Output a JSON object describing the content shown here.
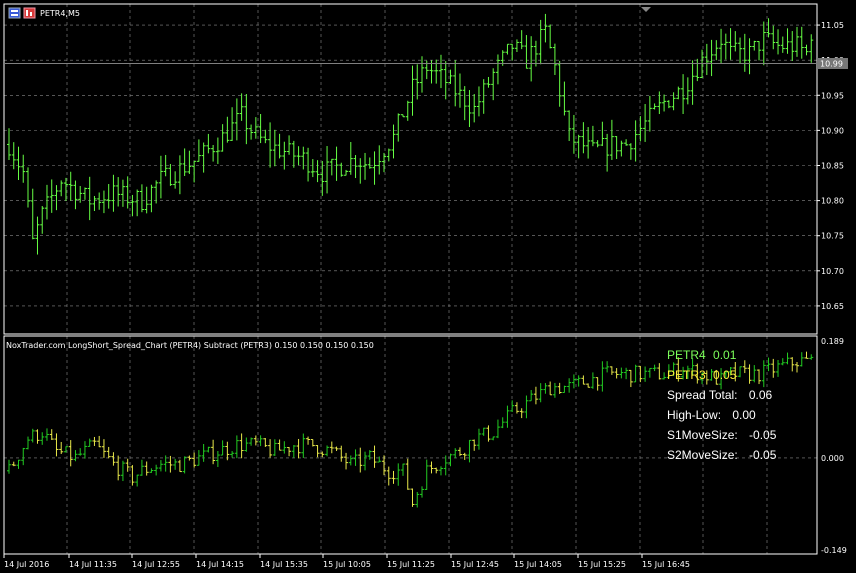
{
  "colors": {
    "background": "#000000",
    "grid": "#8a8a8a",
    "bull": "#66ff44",
    "bear": "#66ff44",
    "spread_up": "#22cc22",
    "spread_down": "#e8e84a",
    "text": "#ffffff",
    "price_line": "#808080",
    "price_tag_bg": "#777777"
  },
  "main_title": "PETR4,M5",
  "indicator_title": "NoxTrader.com LongShort_Spread_Chart (PETR4) Subtract (PETR3) 0.150 0.150 0.150 0.150",
  "price_tag": "10.99",
  "info_panel": {
    "petr4_label": "PETR4",
    "petr4_value": "0.01",
    "petr3_label": "PETR3",
    "petr3_value": "0.05",
    "spread_label": "Spread Total:",
    "spread_value": "0.06",
    "highlow_label": "High-Low:",
    "highlow_value": "0.00",
    "s1_label": "S1MoveSize:",
    "s1_value": "-0.05",
    "s2_label": "S2MoveSize:",
    "s2_value": "-0.05"
  },
  "chart_data": [
    {
      "type": "candlestick",
      "symbol": "PETR4,M5",
      "ylim": [
        10.61,
        11.08
      ],
      "y_ticks": [
        "11.05",
        "11.00",
        "10.95",
        "10.90",
        "10.85",
        "10.80",
        "10.75",
        "10.70",
        "10.65"
      ],
      "current_price": 10.99,
      "x_ticks": [
        "14 Jul 2016",
        "14 Jul 11:35",
        "14 Jul 12:55",
        "14 Jul 14:15",
        "14 Jul 15:35",
        "15 Jul 10:05",
        "15 Jul 11:25",
        "15 Jul 12:45",
        "15 Jul 14:05",
        "15 Jul 15:25",
        "15 Jul 16:45"
      ],
      "close_path": [
        [
          0,
          10.88
        ],
        [
          3,
          10.84
        ],
        [
          5,
          10.74
        ],
        [
          7,
          10.78
        ],
        [
          11,
          10.83
        ],
        [
          17,
          10.8
        ],
        [
          22,
          10.81
        ],
        [
          28,
          10.8
        ],
        [
          32,
          10.83
        ],
        [
          40,
          10.86
        ],
        [
          45,
          10.89
        ],
        [
          49,
          10.92
        ],
        [
          51,
          10.9
        ],
        [
          54,
          10.88
        ],
        [
          58,
          10.87
        ],
        [
          62,
          10.86
        ],
        [
          66,
          10.84
        ],
        [
          70,
          10.85
        ],
        [
          73,
          10.86
        ],
        [
          76,
          10.85
        ],
        [
          81,
          10.89
        ],
        [
          85,
          10.96
        ],
        [
          88,
          10.99
        ],
        [
          92,
          10.97
        ],
        [
          95,
          10.95
        ],
        [
          98,
          10.93
        ],
        [
          102,
          10.98
        ],
        [
          106,
          11.02
        ],
        [
          109,
          11.0
        ],
        [
          113,
          11.04
        ],
        [
          115,
          10.99
        ],
        [
          118,
          10.89
        ],
        [
          123,
          10.87
        ],
        [
          127,
          10.88
        ],
        [
          130,
          10.88
        ],
        [
          134,
          10.91
        ],
        [
          138,
          10.94
        ],
        [
          142,
          10.96
        ],
        [
          146,
          11.0
        ],
        [
          150,
          11.03
        ],
        [
          152,
          11.01
        ],
        [
          156,
          11.01
        ],
        [
          159,
          11.03
        ],
        [
          162,
          11.02
        ],
        [
          166,
          11.02
        ],
        [
          168,
          11.01
        ],
        [
          169,
          11.04
        ]
      ]
    },
    {
      "type": "bar",
      "name": "LongShort_Spread_Chart (PETR4) Subtract (PETR3)",
      "ylim": [
        -0.149,
        0.189
      ],
      "y_ticks": [
        "0.189",
        "0.000",
        "-0.149"
      ],
      "path": [
        [
          0,
          -0.02
        ],
        [
          4,
          0.03
        ],
        [
          7,
          0.04
        ],
        [
          10,
          0.01
        ],
        [
          14,
          0.0
        ],
        [
          18,
          0.02
        ],
        [
          22,
          -0.01
        ],
        [
          26,
          -0.03
        ],
        [
          28,
          -0.02
        ],
        [
          32,
          -0.01
        ],
        [
          36,
          -0.01
        ],
        [
          40,
          0.0
        ],
        [
          44,
          0.01
        ],
        [
          48,
          0.02
        ],
        [
          52,
          0.02
        ],
        [
          56,
          0.01
        ],
        [
          60,
          0.02
        ],
        [
          64,
          0.02
        ],
        [
          68,
          0.01
        ],
        [
          72,
          -0.01
        ],
        [
          76,
          0.0
        ],
        [
          80,
          -0.02
        ],
        [
          83,
          -0.02
        ],
        [
          85,
          -0.07
        ],
        [
          88,
          -0.02
        ],
        [
          92,
          0.0
        ],
        [
          95,
          0.01
        ],
        [
          98,
          0.03
        ],
        [
          102,
          0.04
        ],
        [
          106,
          0.07
        ],
        [
          110,
          0.09
        ],
        [
          114,
          0.11
        ],
        [
          118,
          0.11
        ],
        [
          122,
          0.12
        ],
        [
          126,
          0.13
        ],
        [
          130,
          0.13
        ],
        [
          134,
          0.13
        ],
        [
          138,
          0.13
        ],
        [
          142,
          0.14
        ],
        [
          146,
          0.13
        ],
        [
          150,
          0.12
        ],
        [
          152,
          0.13
        ],
        [
          155,
          0.13
        ],
        [
          158,
          0.13
        ],
        [
          162,
          0.14
        ],
        [
          166,
          0.15
        ],
        [
          169,
          0.15
        ]
      ]
    }
  ]
}
